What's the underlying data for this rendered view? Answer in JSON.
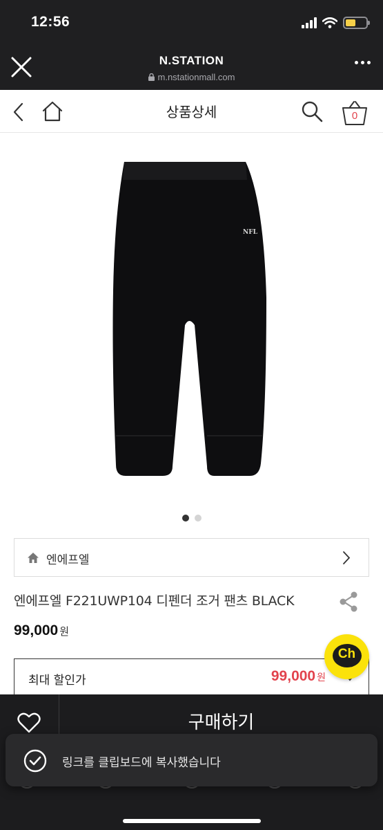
{
  "status_bar": {
    "time": "12:56"
  },
  "browser": {
    "title": "N.STATION",
    "url": "m.nstationmall.com"
  },
  "header": {
    "title": "상품상세",
    "cart_count": "0"
  },
  "product": {
    "brand": "엔에프엘",
    "name": "엔에프엘 F221UWP104 디펜더 조거 팬츠 BLACK",
    "price": "99,000",
    "price_unit": "원",
    "image_logo_text": "NFL",
    "image_color": "#0e0e10",
    "gallery_total": 2,
    "gallery_active": 1
  },
  "discount": {
    "label": "최대 할인가",
    "price": "99,000",
    "unit": "원"
  },
  "chat": {
    "label": "Ch"
  },
  "bottom": {
    "buy_label": "구매하기"
  },
  "toast": {
    "message": "링크를 클립보드에 복사했습니다"
  },
  "colors": {
    "accent": "#e2434d",
    "chat": "#fbe20b",
    "dark_bar": "#1c1c1e"
  }
}
